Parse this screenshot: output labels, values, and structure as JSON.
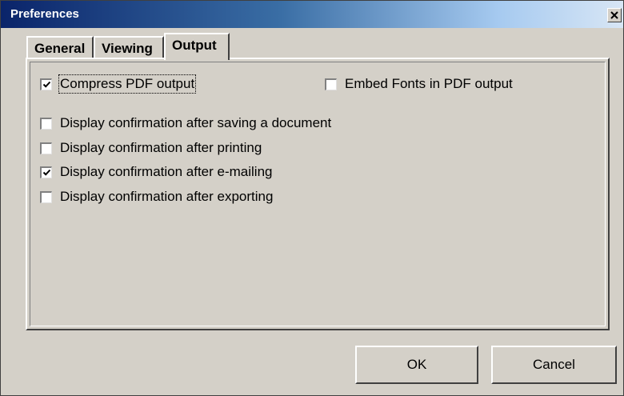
{
  "window": {
    "title": "Preferences",
    "close_icon": "close-icon"
  },
  "tabs": [
    {
      "label": "General",
      "active": false
    },
    {
      "label": "Viewing",
      "active": false
    },
    {
      "label": "Output",
      "active": true
    }
  ],
  "options": {
    "compress_pdf": {
      "label": "Compress PDF output",
      "checked": true,
      "focused": true
    },
    "embed_fonts": {
      "label": "Embed Fonts in PDF output",
      "checked": false
    },
    "confirm_saving": {
      "label": "Display confirmation after saving a document",
      "checked": false
    },
    "confirm_printing": {
      "label": "Display confirmation after printing",
      "checked": false
    },
    "confirm_emailing": {
      "label": "Display confirmation after e-mailing",
      "checked": true
    },
    "confirm_exporting": {
      "label": "Display confirmation after exporting",
      "checked": false
    }
  },
  "buttons": {
    "ok_label": "OK",
    "cancel_label": "Cancel"
  },
  "colors": {
    "titlebar_start": "#0a246a",
    "titlebar_end": "#d8e6f5",
    "face": "#d4d0c8"
  }
}
